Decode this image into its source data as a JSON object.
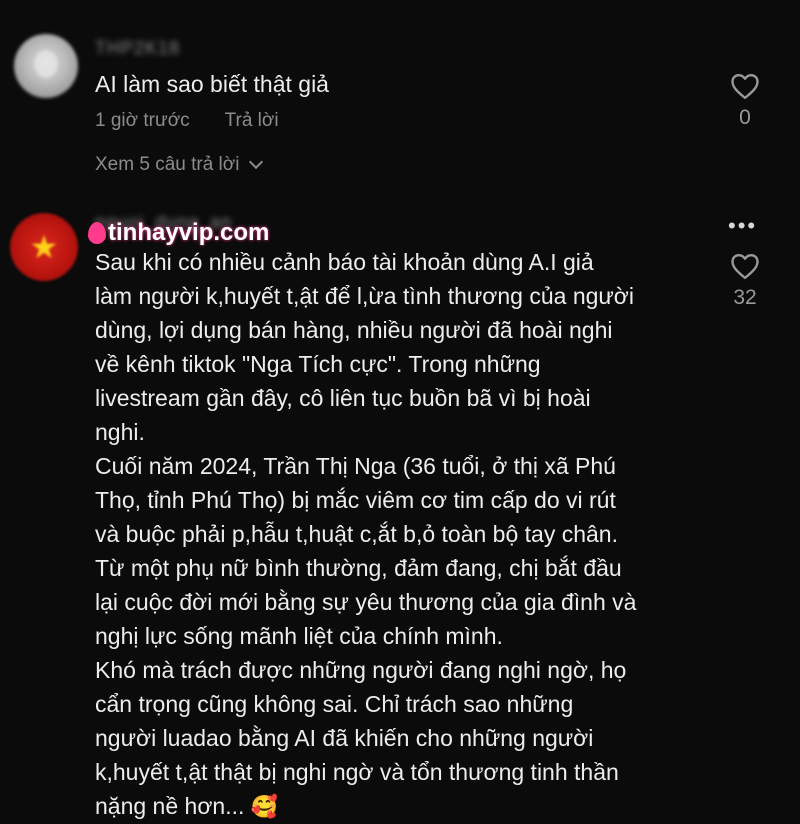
{
  "comments": [
    {
      "username": "THP2K18",
      "text": "AI làm sao biết thật giả",
      "time": "1 giờ trước",
      "reply_label": "Trả lời",
      "view_replies": "Xem 5 câu trả lời",
      "likes": "0"
    },
    {
      "username": "nguoi_dung_an",
      "watermark": "tinhayvip.com",
      "text": "Sau khi có nhiều cảnh báo tài khoản dùng A.I giả\nlàm người k,huyết t,ật để l,ừa tình thương của người\ndùng, lợi dụng bán hàng, nhiều người đã hoài nghi\nvề kênh tiktok \"Nga Tích cực\". Trong những\nlivestream gần đây, cô liên tục buồn bã vì bị hoài\nnghi.\nCuối năm 2024, Trần Thị Nga (36 tuổi, ở thị xã Phú\nThọ, tỉnh Phú Thọ) bị mắc viêm cơ tim cấp do vi rút\nvà buộc phải p,hẫu t,huật c,ắt b,ỏ toàn bộ tay chân.\nTừ một phụ nữ bình thường, đảm đang, chị bắt đầu\nlại cuộc đời mới bằng sự yêu thương của gia đình và\nnghị lực sống mãnh liệt của chính mình.\nKhó mà trách được những người đang nghi ngờ, họ\ncẩn trọng cũng không sai. Chỉ trách sao những\nngười luadao bằng AI đã khiến cho những người\nk,huyết t,ật thật bị nghi ngờ và tổn thương tinh thần\nnặng nề hơn... ",
      "emoji": "🥰",
      "likes": "32"
    }
  ],
  "icons": {
    "like": "heart-outline-icon",
    "more": "more-dots-icon",
    "expand": "chevron-down-icon"
  },
  "colors": {
    "background": "#0b0b0b",
    "text": "#ededed",
    "muted": "#8c8c8c",
    "watermark_accent": "#ff3b8c"
  }
}
